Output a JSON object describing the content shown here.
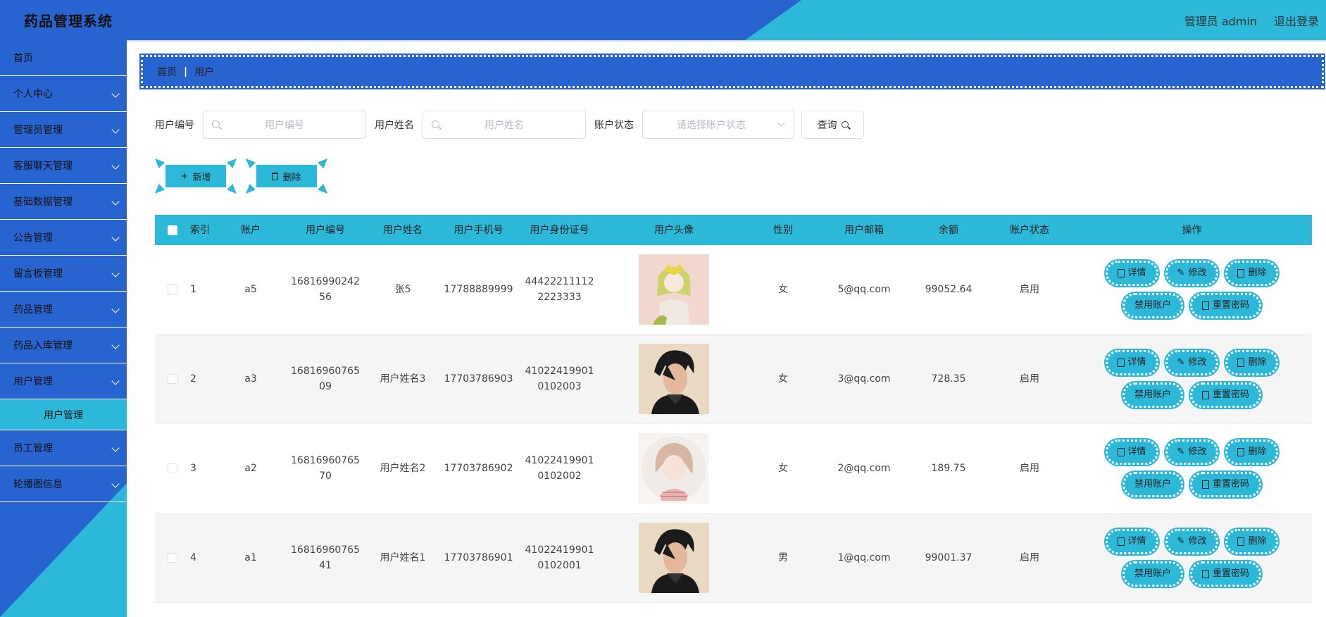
{
  "app": {
    "title": "药品管理系统"
  },
  "header": {
    "admin_label": "管理员 admin",
    "logout_label": "退出登录"
  },
  "sidebar": {
    "items": [
      {
        "label": "首页",
        "has_arrow": false
      },
      {
        "label": "个人中心",
        "has_arrow": true
      },
      {
        "label": "管理员管理",
        "has_arrow": true
      },
      {
        "label": "客服聊天管理",
        "has_arrow": true
      },
      {
        "label": "基础数据管理",
        "has_arrow": true
      },
      {
        "label": "公告管理",
        "has_arrow": true
      },
      {
        "label": "留言板管理",
        "has_arrow": true
      },
      {
        "label": "药品管理",
        "has_arrow": true
      },
      {
        "label": "药品入库管理",
        "has_arrow": true
      },
      {
        "label": "用户管理",
        "has_arrow": true
      }
    ],
    "sub_item": "用户管理",
    "items_after": [
      {
        "label": "员工管理",
        "has_arrow": true
      },
      {
        "label": "轮播图信息",
        "has_arrow": true
      }
    ]
  },
  "breadcrumb": {
    "home": "首页",
    "current": "用户"
  },
  "search": {
    "user_no_label": "用户编号",
    "user_no_placeholder": "用户编号",
    "user_name_label": "用户姓名",
    "user_name_placeholder": "用户姓名",
    "status_label": "账户状态",
    "status_placeholder": "请选择账户状态",
    "query_label": "查询"
  },
  "actions": {
    "add_label": "新增",
    "delete_label": "删除"
  },
  "table": {
    "columns": [
      "索引",
      "账户",
      "用户编号",
      "用户姓名",
      "用户手机号",
      "用户身份证号",
      "用户头像",
      "性别",
      "用户邮箱",
      "余额",
      "账户状态",
      "操作"
    ],
    "rows": [
      {
        "index": "1",
        "account": "a5",
        "user_no_1": "16816990242",
        "user_no_2": "56",
        "name": "张5",
        "phone": "17788889999",
        "id_1": "44422211112",
        "id_2": "2223333",
        "avatar": "girl-yellow",
        "gender": "女",
        "email": "5@qq.com",
        "balance": "99052.64",
        "status": "启用"
      },
      {
        "index": "2",
        "account": "a3",
        "user_no_1": "16816960765",
        "user_no_2": "09",
        "name": "用户姓名3",
        "phone": "17703786903",
        "id_1": "41022419901",
        "id_2": "0102003",
        "avatar": "boy-dark",
        "gender": "女",
        "email": "3@qq.com",
        "balance": "728.35",
        "status": "启用"
      },
      {
        "index": "3",
        "account": "a2",
        "user_no_1": "16816960765",
        "user_no_2": "70",
        "name": "用户姓名2",
        "phone": "17703786902",
        "id_1": "41022419901",
        "id_2": "0102002",
        "avatar": "girl-round",
        "gender": "女",
        "email": "2@qq.com",
        "balance": "189.75",
        "status": "启用"
      },
      {
        "index": "4",
        "account": "a1",
        "user_no_1": "16816960765",
        "user_no_2": "41",
        "name": "用户姓名1",
        "phone": "17703786901",
        "id_1": "41022419901",
        "id_2": "0102001",
        "avatar": "boy-dark",
        "gender": "男",
        "email": "1@qq.com",
        "balance": "99001.37",
        "status": "启用"
      }
    ],
    "row_actions": {
      "detail": "详情",
      "edit": "修改",
      "delete": "删除",
      "disable": "禁用账户",
      "reset": "重置密码"
    }
  },
  "colors": {
    "primary_blue": "#2864d0",
    "accent_cyan": "#2cb8d9"
  }
}
